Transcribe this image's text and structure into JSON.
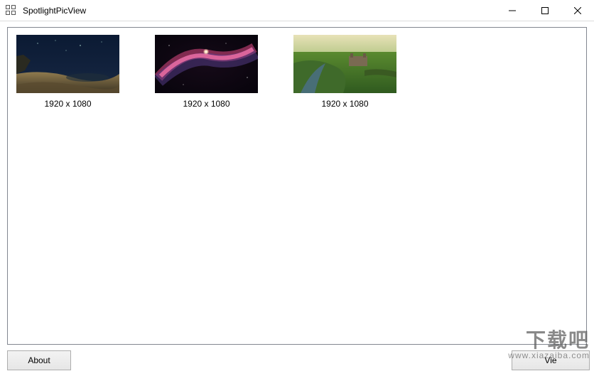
{
  "window": {
    "title": "SpotlightPicView"
  },
  "thumbnails": [
    {
      "caption": "1920 x 1080"
    },
    {
      "caption": "1920 x 1080"
    },
    {
      "caption": "1920 x 1080"
    }
  ],
  "buttons": {
    "about": "About",
    "right": "Vie"
  },
  "watermark": {
    "line1": "下载吧",
    "line2": "www.xiazaiba.com"
  }
}
